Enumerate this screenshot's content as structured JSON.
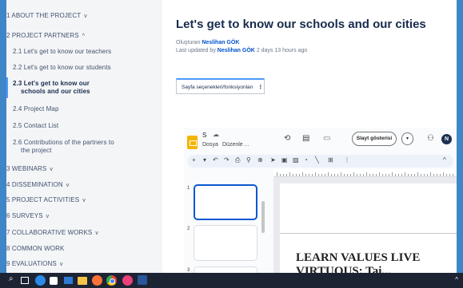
{
  "nav": {
    "items": [
      {
        "label": "1 ABOUT THE PROJECT",
        "chevron": "v"
      },
      {
        "label": "2 PROJECT PARTNERS",
        "chevron": "^"
      },
      {
        "label": "2.1 Let's get to know our teachers"
      },
      {
        "label": "2.2 Let's get to know our students"
      },
      {
        "label": "2.3 Let's get to know our",
        "label2": "schools and our cities"
      },
      {
        "label": "2.4 Project Map"
      },
      {
        "label": "2.5 Contact List"
      },
      {
        "label": "2.6 Contributions of the partners to",
        "label2": "the project"
      },
      {
        "label": "3 WEBINARS",
        "chevron": "v"
      },
      {
        "label": "4 DISSEMINATION",
        "chevron": "v"
      },
      {
        "label": "5 PROJECT ACTIVITIES",
        "chevron": "v"
      },
      {
        "label": "6 SURVEYS",
        "chevron": "v"
      },
      {
        "label": "7 COLLABORATIVE WORKS",
        "chevron": "v"
      },
      {
        "label": "8 COMMON WORK"
      },
      {
        "label": "9 EVALUATIONS",
        "chevron": "v"
      }
    ]
  },
  "page": {
    "title": "Let's get to know our schools and our cities",
    "created_prefix": "Oluşturan",
    "created_by": "Neslihan GÖK",
    "updated_prefix": "Last updated by",
    "updated_by": "Neslihan GÖK",
    "updated_when": "2 days 13 hours ago",
    "options_label": "Sayfa seçenekleri/fonksiyonları",
    "options_kebab": "⋮"
  },
  "slides": {
    "doc_title": "S",
    "menu_file": "Dosya",
    "menu_edit": "Düzenle ...",
    "slideshow_button": "Slayt gösterisi",
    "slideshow_arrow": "▾",
    "avatar_initial": "N",
    "thumb_numbers": [
      "1",
      "2",
      "3"
    ],
    "slide_text_line1": "LEARN VALUES LIVE",
    "slide_text_line2": "VIRTUOUS: Tai..."
  },
  "colors": {
    "frame": "#3f86c8",
    "nav_bg": "#f4f5f7",
    "link": "#0052cc",
    "taskbar": "#1c2434",
    "slides_yellow": "#f4b400"
  },
  "icons": {
    "history": "history-icon",
    "comment": "comment-icon",
    "camera": "video-call-icon",
    "share": "add-person-icon"
  }
}
